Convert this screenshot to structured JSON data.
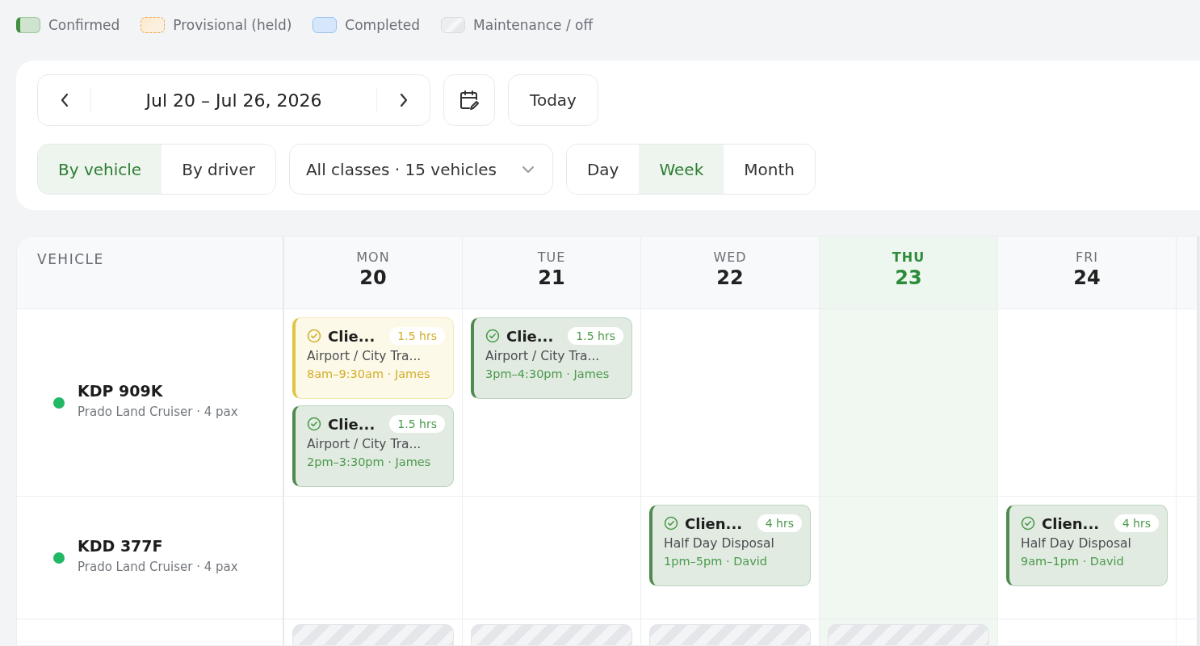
{
  "legend": [
    {
      "label": "Confirmed",
      "kind": "confirmed"
    },
    {
      "label": "Provisional (held)",
      "kind": "provisional"
    },
    {
      "label": "Completed",
      "kind": "completed"
    },
    {
      "label": "Maintenance / off",
      "kind": "maintenance"
    }
  ],
  "toolbar": {
    "date_range": "Jul 20 – Jul 26, 2026",
    "today_button": "Today",
    "group_by": [
      {
        "label": "By vehicle",
        "selected": true
      },
      {
        "label": "By driver",
        "selected": false
      }
    ],
    "filter": "All classes · 15 vehicles",
    "views": [
      {
        "label": "Day",
        "selected": false
      },
      {
        "label": "Week",
        "selected": true
      },
      {
        "label": "Month",
        "selected": false
      }
    ]
  },
  "grid": {
    "column_header": "VEHICLE",
    "days": [
      {
        "weekday": "MON",
        "date": "20",
        "today": false
      },
      {
        "weekday": "TUE",
        "date": "21",
        "today": false
      },
      {
        "weekday": "WED",
        "date": "22",
        "today": false
      },
      {
        "weekday": "THU",
        "date": "23",
        "today": true
      },
      {
        "weekday": "FRI",
        "date": "24",
        "today": false
      }
    ],
    "rows": [
      {
        "plate": "KDP 909K",
        "model": "Prado Land Cruiser · 4 pax",
        "color": "#22b865",
        "cells": [
          {
            "bookings": [
              {
                "kind": "provisional",
                "title": "Clie...",
                "duration": "1.5 hrs",
                "service": "Airport / City Tra...",
                "time": "8am–9:30am · James"
              },
              {
                "kind": "confirmed",
                "title": "Clie...",
                "duration": "1.5 hrs",
                "service": "Airport / City Tra...",
                "time": "2pm–3:30pm · James"
              }
            ]
          },
          {
            "bookings": [
              {
                "kind": "confirmed",
                "title": "Clie...",
                "duration": "1.5 hrs",
                "service": "Airport / City Tra...",
                "time": "3pm–4:30pm · James"
              }
            ]
          },
          {},
          {},
          {}
        ]
      },
      {
        "plate": "KDD 377F",
        "model": "Prado Land Cruiser · 4 pax",
        "color": "#22b865",
        "cells": [
          {},
          {},
          {
            "bookings": [
              {
                "kind": "confirmed",
                "title": "Clien...",
                "duration": "4 hrs",
                "service": "Half Day Disposal",
                "time": "1pm–5pm · David"
              }
            ]
          },
          {},
          {
            "bookings": [
              {
                "kind": "confirmed",
                "title": "Clien...",
                "duration": "4 hrs",
                "service": "Half Day Disposal",
                "time": "9am–1pm · David"
              }
            ]
          }
        ]
      },
      {
        "cells": [
          {
            "bookings": [
              {
                "kind": "maintenance"
              }
            ]
          },
          {
            "bookings": [
              {
                "kind": "maintenance"
              }
            ]
          },
          {
            "bookings": [
              {
                "kind": "maintenance"
              }
            ]
          },
          {
            "bookings": [
              {
                "kind": "maintenance"
              }
            ]
          },
          {}
        ]
      }
    ]
  }
}
